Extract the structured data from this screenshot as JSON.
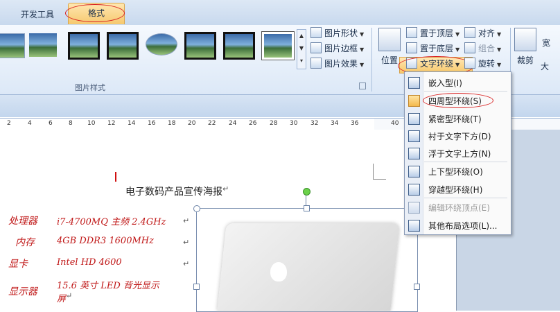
{
  "tabs": {
    "dev": "开发工具",
    "format": "格式"
  },
  "ribbon": {
    "picture_styles_label": "图片样式",
    "picture_shape": "图片形状",
    "picture_border": "图片边框",
    "picture_effects": "图片效果",
    "position": "位置",
    "bring_front": "置于顶层",
    "send_back": "置于底层",
    "text_wrap": "文字环绕",
    "align": "对齐",
    "group": "组合",
    "rotate": "旋转",
    "crop": "裁剪",
    "width_partial": "宽",
    "more_partial": "大"
  },
  "ruler": {
    "ticks": [
      "2",
      "4",
      "6",
      "8",
      "10",
      "12",
      "14",
      "16",
      "18",
      "20",
      "22",
      "24",
      "26",
      "28",
      "30",
      "32",
      "34",
      "36",
      "40"
    ]
  },
  "wrap_menu": {
    "items": [
      {
        "label": "嵌入型(I)",
        "selected": false,
        "disabled": false
      },
      {
        "label": "四周型环绕(S)",
        "selected": true,
        "disabled": false
      },
      {
        "label": "紧密型环绕(T)",
        "selected": false,
        "disabled": false
      },
      {
        "label": "衬于文字下方(D)",
        "selected": false,
        "disabled": false
      },
      {
        "label": "浮于文字上方(N)",
        "selected": false,
        "disabled": false
      },
      {
        "label": "上下型环绕(O)",
        "selected": false,
        "disabled": false
      },
      {
        "label": "穿越型环绕(H)",
        "selected": false,
        "disabled": false
      },
      {
        "label": "编辑环绕顶点(E)",
        "selected": false,
        "disabled": true
      },
      {
        "label": "其他布局选项(L)...",
        "selected": false,
        "disabled": false
      }
    ]
  },
  "document": {
    "title": "电子数码产品宣传海报",
    "paragraph_mark": "↵",
    "specs": [
      {
        "label": "处理器",
        "value": "i7-4700MQ 主频 2.4GHz"
      },
      {
        "label": "内存",
        "value": "4GB DDR3 1600MHz"
      },
      {
        "label": "显卡",
        "value": "Intel HD 4600"
      },
      {
        "label": "显示器",
        "value": "15.6 英寸 LED 背光显示"
      }
    ],
    "spec_continuation": "屏"
  },
  "colors": {
    "annotation_oval": "#d92020",
    "spec_text": "#c01818",
    "selected_item": "#f5b94c"
  }
}
